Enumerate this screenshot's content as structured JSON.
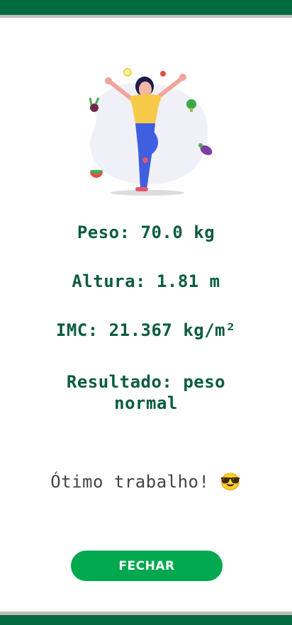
{
  "app": {
    "accent_color": "#006b3f",
    "button_color": "#00a84f",
    "text_color": "#0a5b3f"
  },
  "result": {
    "peso_label": "Peso: 70.0 kg",
    "altura_label": "Altura: 1.81 m",
    "imc_label": "IMC: 21.367 kg/m²",
    "resultado_label": "Resultado: peso normal",
    "message": "Ótimo trabalho! 😎"
  },
  "actions": {
    "close_label": "FECHAR"
  },
  "illustration": {
    "icon": "woman-yoga-vegetables-illustration"
  }
}
